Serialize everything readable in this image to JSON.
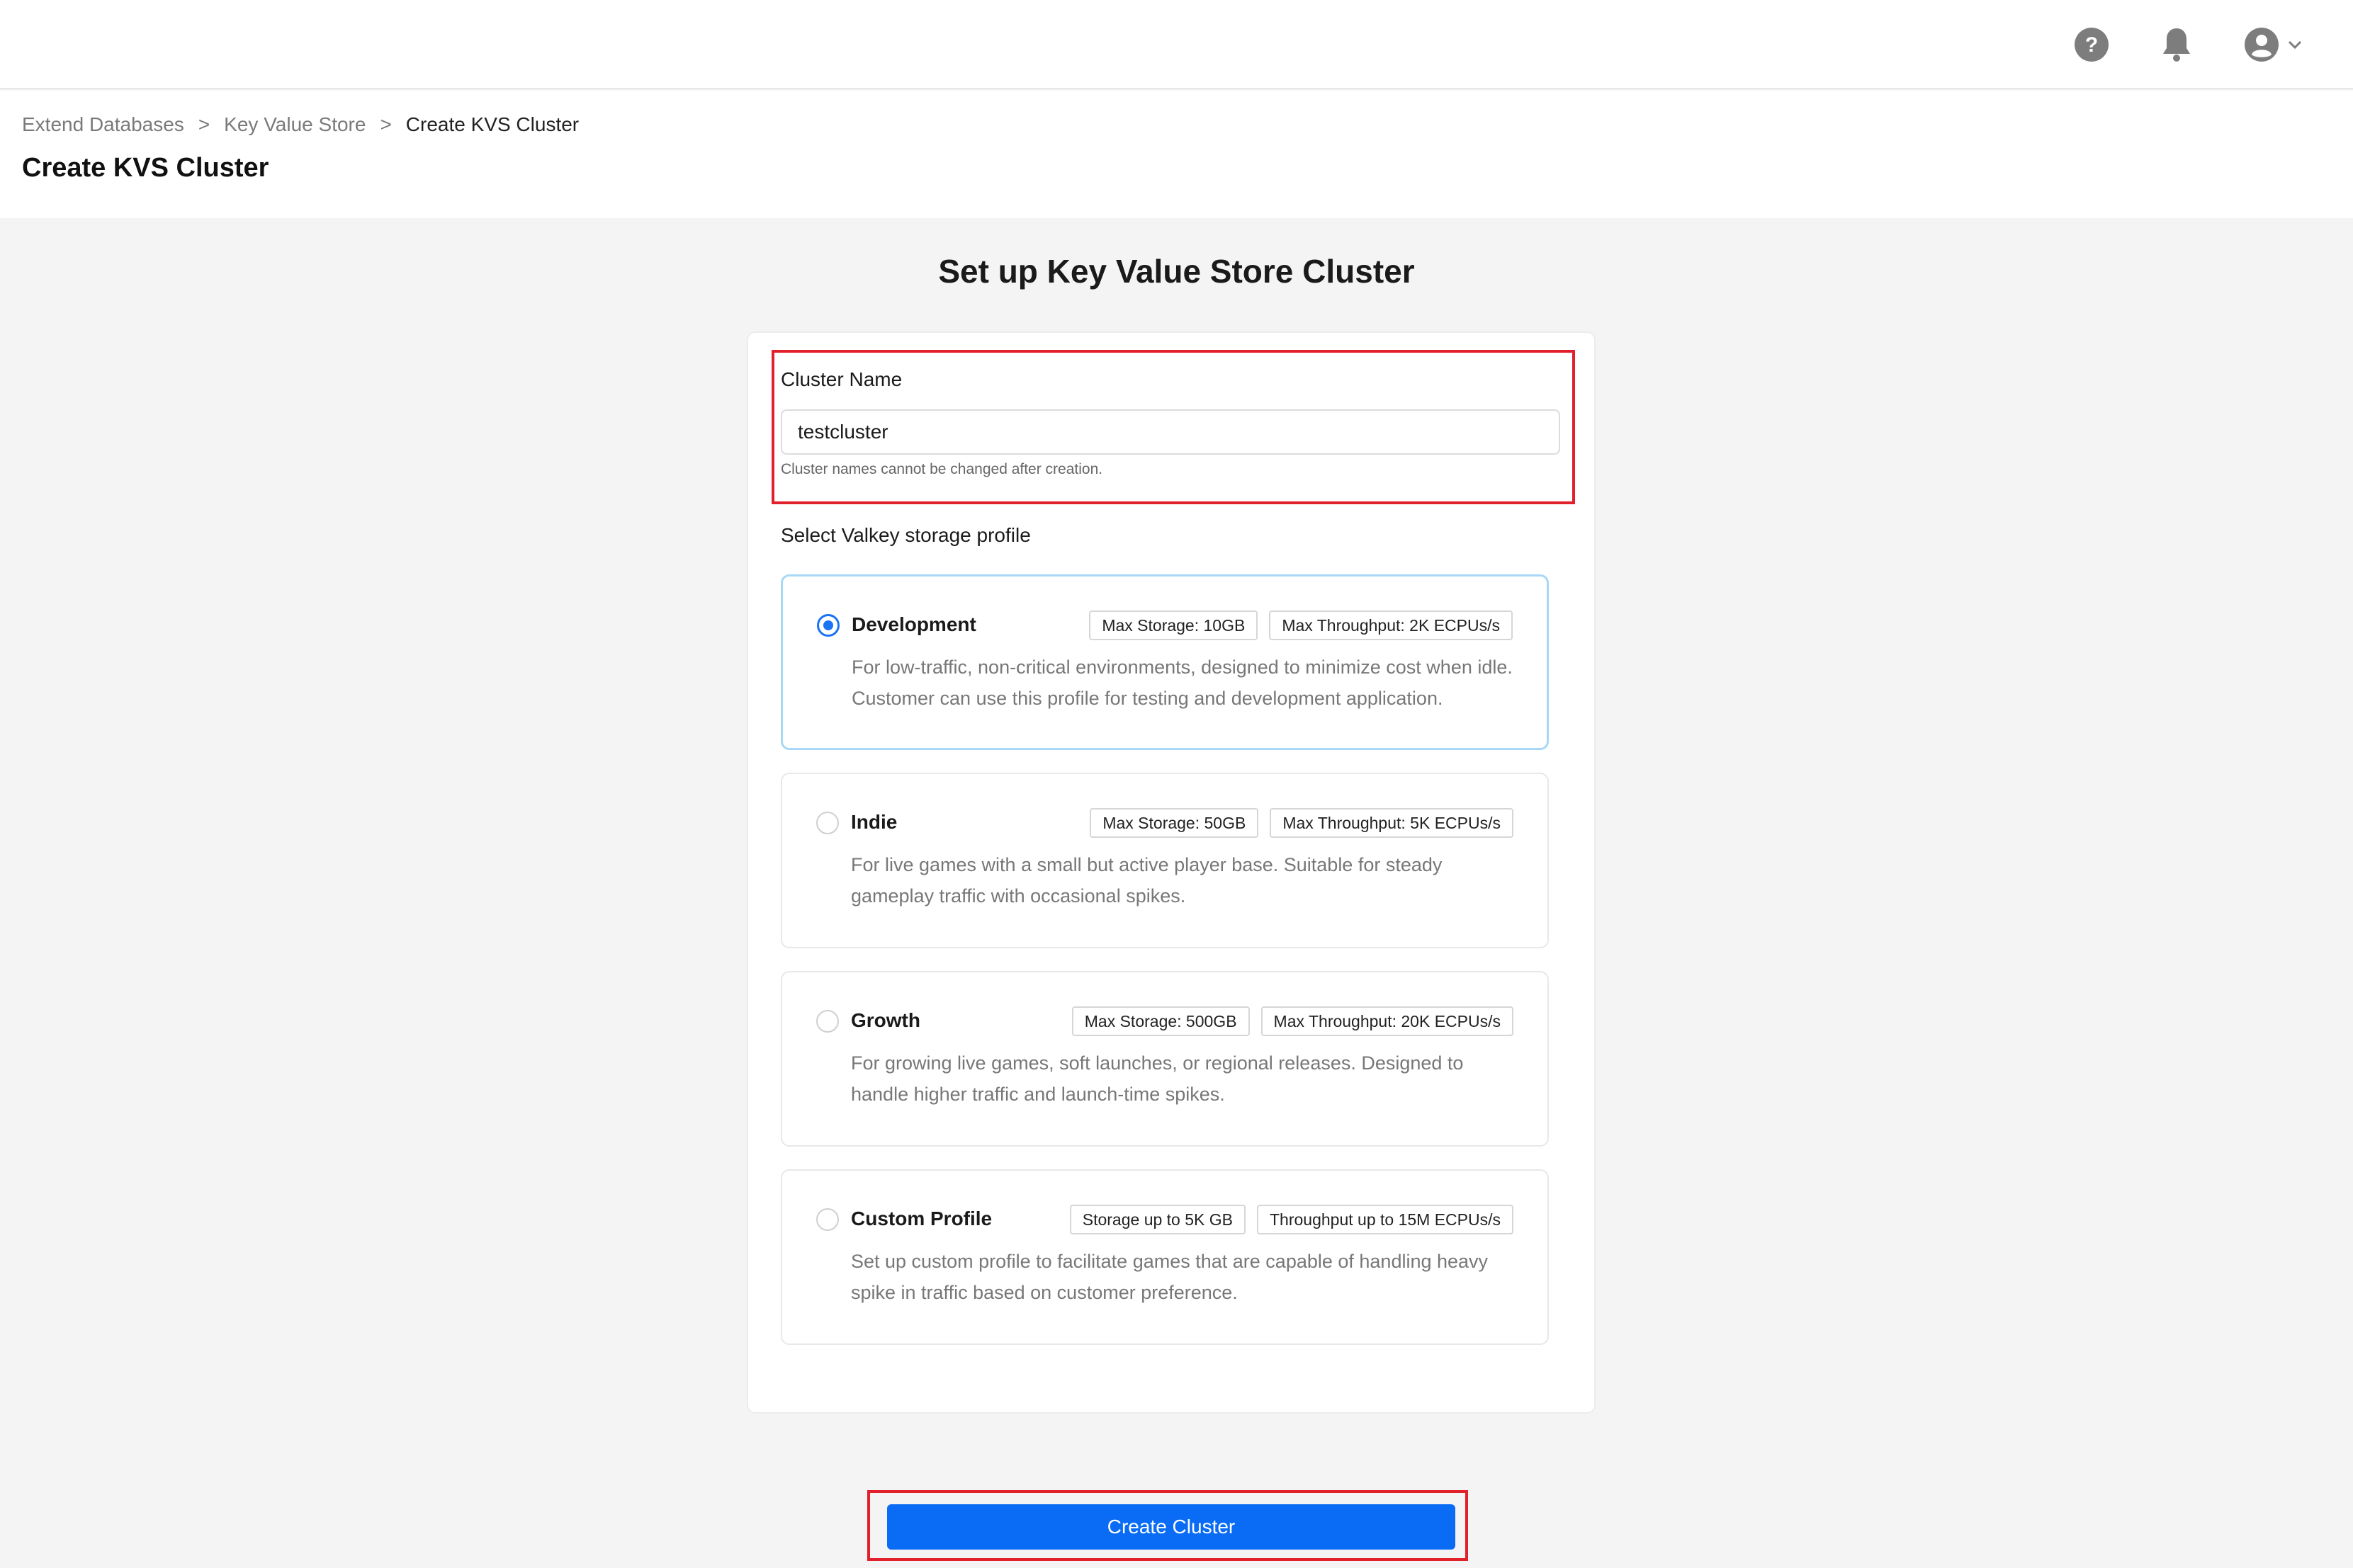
{
  "topbar": {
    "icons": [
      "help-icon",
      "bell-icon",
      "user-account-icon",
      "chevron-down-icon"
    ]
  },
  "breadcrumb": {
    "items": [
      "Extend Databases",
      "Key Value Store",
      "Create KVS Cluster"
    ],
    "separator": ">"
  },
  "page": {
    "title": "Create KVS Cluster",
    "section_title": "Set up Key Value Store Cluster"
  },
  "form": {
    "cluster_name_label": "Cluster Name",
    "cluster_name_value": "testcluster",
    "cluster_name_hint": "Cluster names cannot be changed after creation.",
    "profile_label": "Select Valkey storage profile"
  },
  "profiles": [
    {
      "name": "Development",
      "selected": true,
      "storage": "Max Storage: 10GB",
      "throughput": "Max Throughput: 2K ECPUs/s",
      "description": "For low-traffic, non-critical environments, designed to minimize cost when idle. Customer can use this profile for testing and development application."
    },
    {
      "name": "Indie",
      "selected": false,
      "storage": "Max Storage: 50GB",
      "throughput": "Max Throughput: 5K ECPUs/s",
      "description": "For live games with a small but active player base. Suitable for steady gameplay traffic with occasional spikes."
    },
    {
      "name": "Growth",
      "selected": false,
      "storage": "Max Storage: 500GB",
      "throughput": "Max Throughput: 20K ECPUs/s",
      "description": "For growing live games, soft launches, or regional releases. Designed to handle higher traffic and launch-time spikes."
    },
    {
      "name": "Custom Profile",
      "selected": false,
      "storage": "Storage up to 5K GB",
      "throughput": "Throughput up to 15M ECPUs/s",
      "description": "Set up custom profile to facilitate games that are capable of handling heavy spike in traffic based on customer preference."
    }
  ],
  "actions": {
    "create_label": "Create Cluster"
  },
  "colors": {
    "accent": "#0a6cf5",
    "highlight_border": "#e0202a",
    "selected_card_border": "#a8d8f5"
  }
}
